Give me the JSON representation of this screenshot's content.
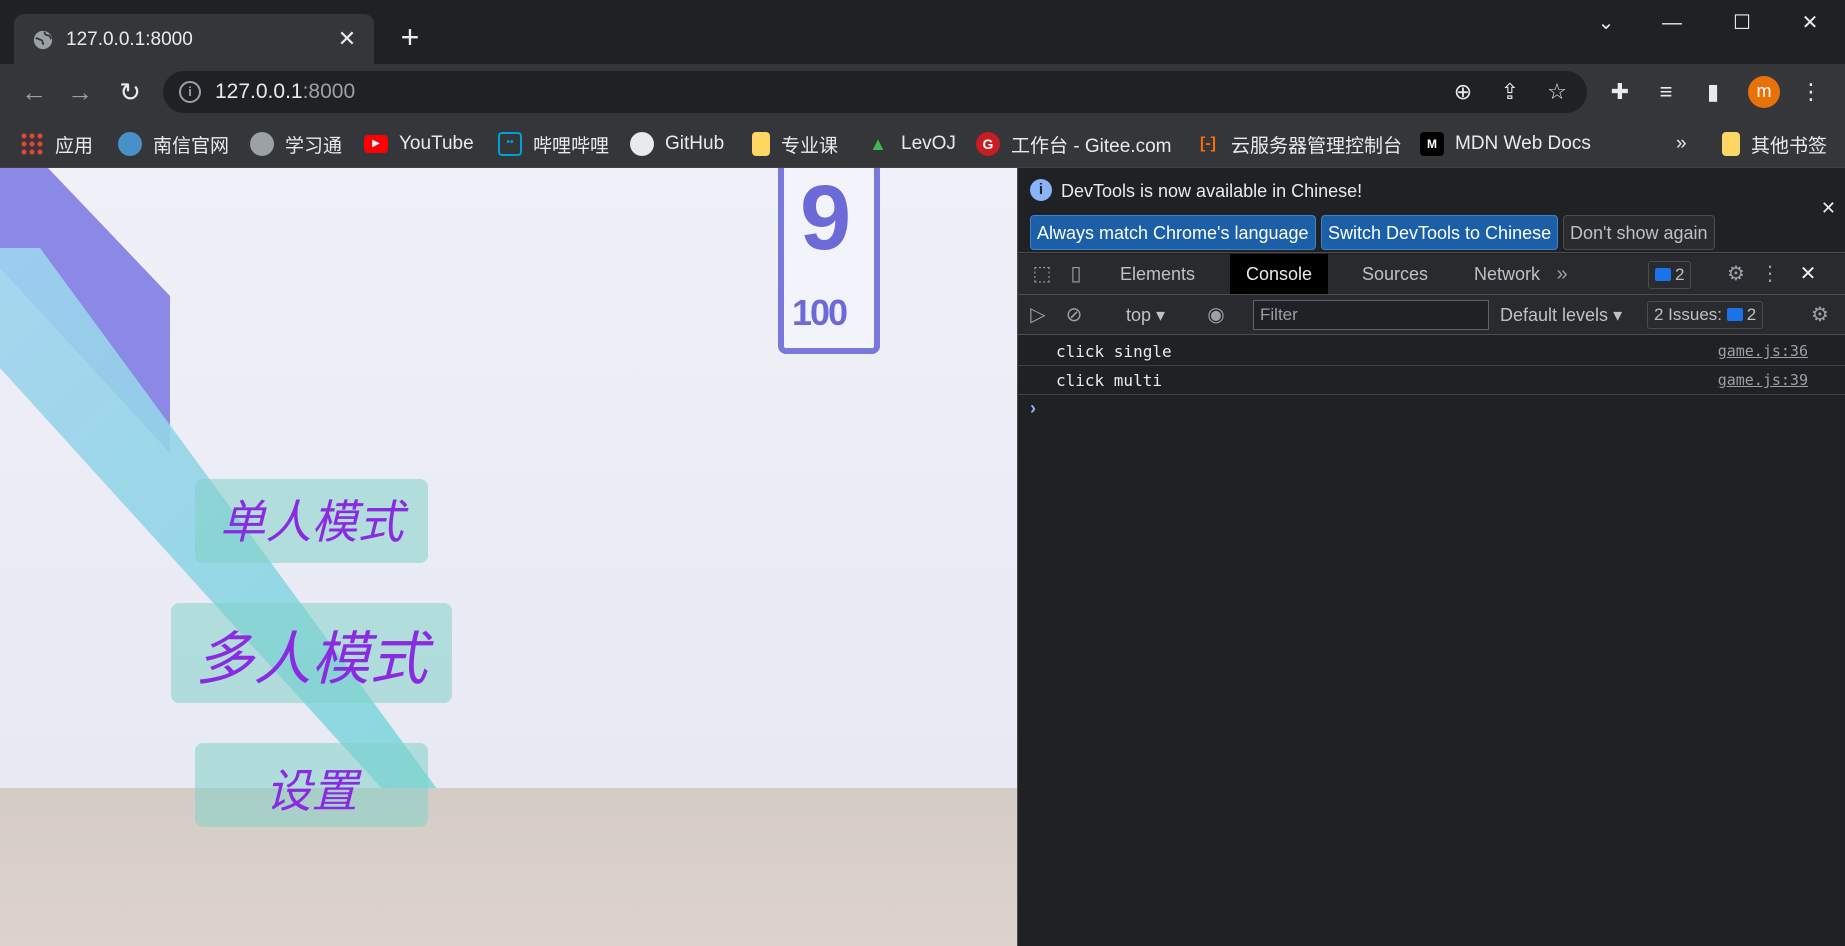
{
  "browser": {
    "tab_title": "127.0.0.1:8000",
    "url_host": "127.0.0.1",
    "url_port": ":8000",
    "profile_initial": "m",
    "bookmarks": [
      {
        "label": "应用",
        "icon": "apps-grid-icon",
        "color": "#ea4335"
      },
      {
        "label": "南信官网",
        "icon": "globe-icon",
        "color": "#4a90c8"
      },
      {
        "label": "学习通",
        "icon": "globe-icon",
        "color": "#9aa0a6"
      },
      {
        "label": "YouTube",
        "icon": "youtube-icon",
        "color": "#ff0000"
      },
      {
        "label": "哔哩哔哩",
        "icon": "bilibili-icon",
        "color": "#00a1d6"
      },
      {
        "label": "GitHub",
        "icon": "github-icon",
        "color": "#e8eaed"
      },
      {
        "label": "专业课",
        "icon": "folder-icon",
        "color": "#fdd663"
      },
      {
        "label": "LevOJ",
        "icon": "levoj-icon",
        "color": "#3fb950"
      },
      {
        "label": "工作台 - Gitee.com",
        "icon": "gitee-icon",
        "color": "#c71d23"
      },
      {
        "label": "云服务器管理控制台",
        "icon": "aliyun-icon",
        "color": "#ff6a00"
      },
      {
        "label": "MDN Web Docs",
        "icon": "mdn-icon",
        "color": "#000000"
      }
    ],
    "bookmarks_overflow": "»",
    "other_bookmarks": "其他书签"
  },
  "game": {
    "single_mode": "单人模式",
    "multi_mode": "多人模式",
    "settings": "设置",
    "sign_number": "100"
  },
  "devtools": {
    "info_message": "DevTools is now available in Chinese!",
    "btn_match": "Always match Chrome's language",
    "btn_switch": "Switch DevTools to Chinese",
    "btn_dont_show": "Don't show again",
    "tabs": [
      "Elements",
      "Console",
      "Sources",
      "Network"
    ],
    "active_tab": "Console",
    "message_count": "2",
    "context": "top",
    "filter_placeholder": "Filter",
    "levels": "Default levels",
    "issues_label": "2 Issues:",
    "issues_count": "2",
    "logs": [
      {
        "text": "click single",
        "source": "game.js:36"
      },
      {
        "text": "click multi",
        "source": "game.js:39"
      }
    ]
  },
  "colors": {
    "accent_purple": "#8a2be2",
    "chrome_dark": "#202124",
    "devtools_primary": "#1a5fa8"
  }
}
